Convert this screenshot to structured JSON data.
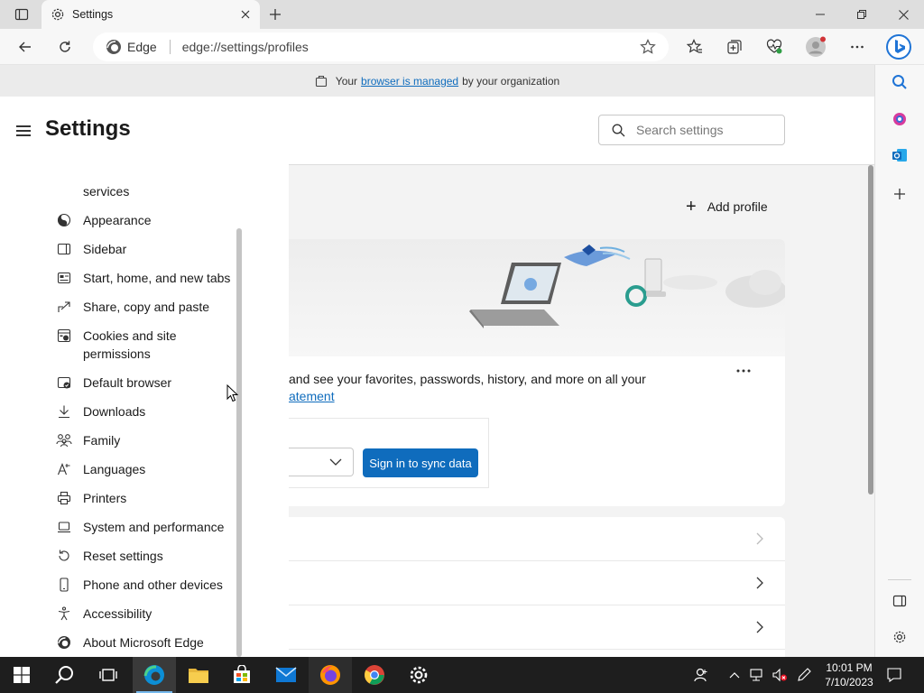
{
  "browser": {
    "tab_title": "Settings",
    "address_brand": "Edge",
    "address_url": "edge://settings/profiles"
  },
  "banner": {
    "prefix": "Your",
    "link": "browser is managed",
    "suffix": "by your organization"
  },
  "settings_nav": {
    "title": "Settings",
    "items": [
      {
        "label": "services",
        "icon": "shield-icon"
      },
      {
        "label": "Appearance",
        "icon": "appearance-icon"
      },
      {
        "label": "Sidebar",
        "icon": "sidebar-icon"
      },
      {
        "label": "Start, home, and new tabs",
        "icon": "home-tabs-icon"
      },
      {
        "label": "Share, copy and paste",
        "icon": "share-icon"
      },
      {
        "label": "Cookies and site permissions",
        "icon": "cookies-icon"
      },
      {
        "label": "Default browser",
        "icon": "default-browser-icon"
      },
      {
        "label": "Downloads",
        "icon": "download-icon"
      },
      {
        "label": "Family",
        "icon": "family-icon"
      },
      {
        "label": "Languages",
        "icon": "languages-icon"
      },
      {
        "label": "Printers",
        "icon": "printer-icon"
      },
      {
        "label": "System and performance",
        "icon": "system-icon"
      },
      {
        "label": "Reset settings",
        "icon": "reset-icon"
      },
      {
        "label": "Phone and other devices",
        "icon": "phone-icon"
      },
      {
        "label": "Accessibility",
        "icon": "accessibility-icon"
      },
      {
        "label": "About Microsoft Edge",
        "icon": "edge-icon"
      }
    ]
  },
  "main": {
    "search_placeholder": "Search settings",
    "add_profile_label": "Add profile",
    "profile_card": {
      "sync_text": "and see your favorites, passwords, history, and more on all your",
      "sync_link": "atement",
      "sign_in_button": "Sign in to sync data"
    }
  },
  "taskbar": {
    "time": "10:01 PM",
    "date": "7/10/2023"
  },
  "colors": {
    "accent": "#0f6cbd",
    "taskbar": "#1e1e1e"
  }
}
